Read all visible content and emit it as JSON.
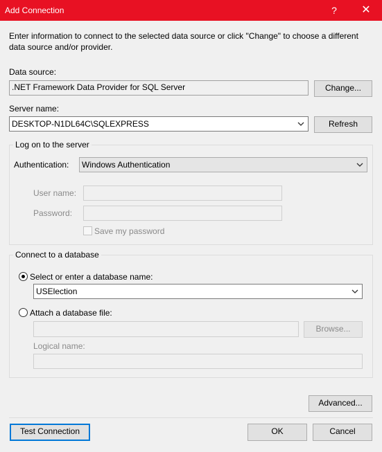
{
  "window": {
    "title": "Add Connection",
    "help_label": "?",
    "close_label": "✕",
    "accent_color": "#e81123"
  },
  "intro_text": "Enter information to connect to the selected data source or click \"Change\" to choose a different data source and/or provider.",
  "data_source": {
    "label": "Data source:",
    "value": ".NET Framework Data Provider for SQL Server",
    "change_label": "Change..."
  },
  "server": {
    "label": "Server name:",
    "value": "DESKTOP-N1DL64C\\SQLEXPRESS",
    "refresh_label": "Refresh"
  },
  "logon": {
    "group_title": "Log on to the server",
    "auth_label": "Authentication:",
    "auth_value": "Windows Authentication",
    "user_label": "User name:",
    "user_value": "",
    "password_label": "Password:",
    "password_value": "",
    "save_password_label": "Save my password",
    "save_password_checked": false
  },
  "database": {
    "group_title": "Connect to a database",
    "select_option_label": "Select or enter a database name:",
    "select_option_selected": true,
    "db_name_value": "USElection",
    "attach_option_label": "Attach a database file:",
    "attach_option_selected": false,
    "attach_file_value": "",
    "browse_label": "Browse...",
    "logical_name_label": "Logical name:",
    "logical_name_value": ""
  },
  "footer": {
    "advanced_label": "Advanced...",
    "test_label": "Test Connection",
    "ok_label": "OK",
    "cancel_label": "Cancel"
  }
}
